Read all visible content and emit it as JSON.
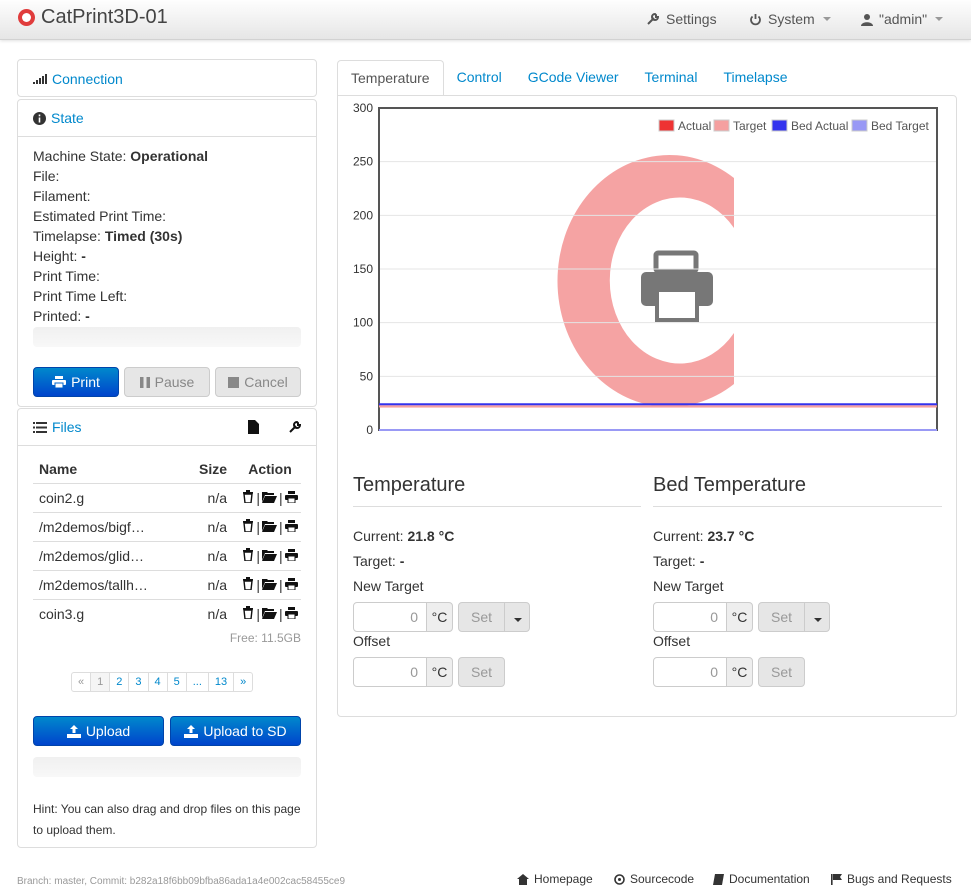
{
  "app": {
    "title": "CatPrint3D-01"
  },
  "nav": {
    "settings": "Settings",
    "system": "System",
    "user": "\"admin\""
  },
  "connection": {
    "title": "Connection"
  },
  "state": {
    "title": "State",
    "rows": [
      {
        "label": "Machine State:",
        "value": "Operational"
      },
      {
        "label": "File:",
        "value": ""
      },
      {
        "label": "Filament:",
        "value": ""
      },
      {
        "label": "Estimated Print Time:",
        "value": ""
      },
      {
        "label": "Timelapse:",
        "value": "Timed (30s)"
      },
      {
        "label": "Height:",
        "value": "-"
      },
      {
        "label": "Print Time:",
        "value": ""
      },
      {
        "label": "Print Time Left:",
        "value": ""
      },
      {
        "label": "Printed:",
        "value": "-"
      }
    ],
    "buttons": {
      "print": "Print",
      "pause": "Pause",
      "cancel": "Cancel"
    }
  },
  "files": {
    "title": "Files",
    "headers": {
      "name": "Name",
      "size": "Size",
      "action": "Action"
    },
    "rows": [
      {
        "name": "coin2.g",
        "size": "n/a"
      },
      {
        "name": "/m2demos/bigf…",
        "size": "n/a"
      },
      {
        "name": "/m2demos/glid…",
        "size": "n/a"
      },
      {
        "name": "/m2demos/tallh…",
        "size": "n/a"
      },
      {
        "name": "coin3.g",
        "size": "n/a"
      }
    ],
    "free": "Free: 11.5GB",
    "pages": [
      "«",
      "1",
      "2",
      "3",
      "4",
      "5",
      "...",
      "13",
      "»"
    ],
    "upload": "Upload",
    "upload_sd": "Upload to SD",
    "hint": "Hint: You can also drag and drop files on this page to upload them."
  },
  "tabs": [
    "Temperature",
    "Control",
    "GCode Viewer",
    "Terminal",
    "Timelapse"
  ],
  "chart_data": {
    "type": "line",
    "ylim": [
      0,
      300
    ],
    "yticks": [
      0,
      50,
      100,
      150,
      200,
      250,
      300
    ],
    "legend_position": "top-right",
    "series": [
      {
        "name": "Actual",
        "color": "#ee3333",
        "y": 22
      },
      {
        "name": "Target",
        "color": "#f5a0a0",
        "y": 22
      },
      {
        "name": "Bed Actual",
        "color": "#3333ee",
        "y": 24
      },
      {
        "name": "Bed Target",
        "color": "#9999f5",
        "y": 0
      }
    ]
  },
  "tool": {
    "title": "Temperature",
    "current_label": "Current:",
    "current": "21.8 °C",
    "target_label": "Target:",
    "target": "-",
    "new_target": "New Target",
    "offset": "Offset",
    "input": "0",
    "unit": "°C",
    "set": "Set"
  },
  "bed": {
    "title": "Bed Temperature",
    "current_label": "Current:",
    "current": "23.7 °C",
    "target_label": "Target:",
    "target": "-",
    "new_target": "New Target",
    "offset": "Offset",
    "input": "0",
    "unit": "°C",
    "set": "Set"
  },
  "footer": {
    "branch": "Branch: master, Commit: b282a18f6bb09bfba86ada1a4e002cac58455ce9",
    "homepage": "Homepage",
    "sourcecode": "Sourcecode",
    "documentation": "Documentation",
    "bugs": "Bugs and Requests"
  }
}
